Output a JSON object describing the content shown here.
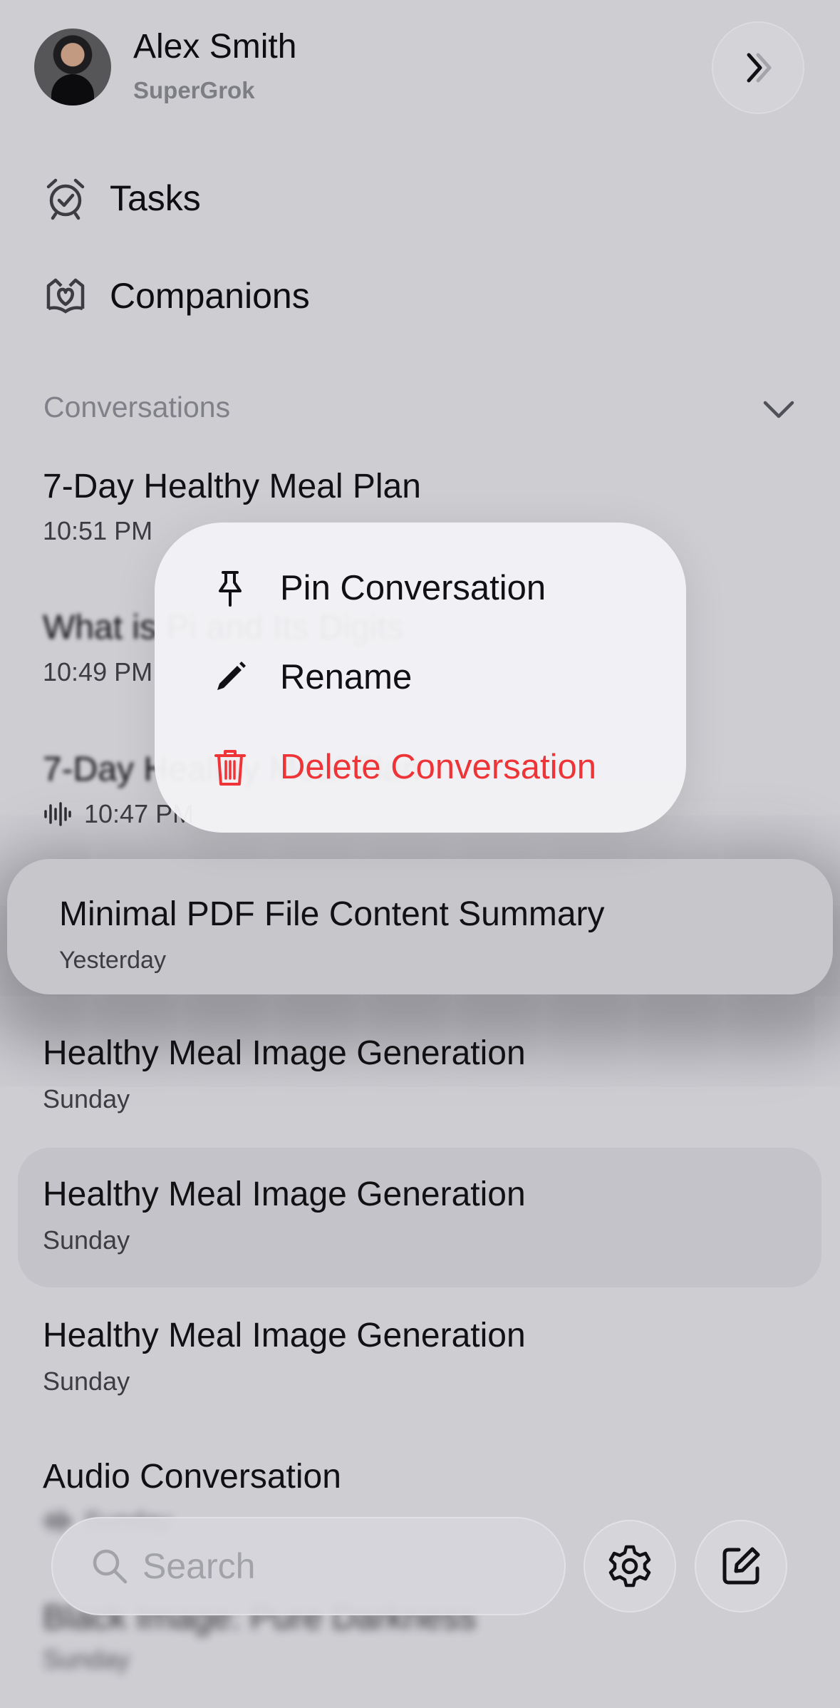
{
  "user": {
    "name": "Alex Smith",
    "plan": "SuperGrok"
  },
  "nav": {
    "tasks_label": "Tasks",
    "companions_label": "Companions"
  },
  "conversations": {
    "section_title": "Conversations",
    "items": [
      {
        "title": "7-Day Healthy Meal Plan",
        "time": "10:51 PM"
      },
      {
        "title": "What is Pi and Its Digits",
        "time": "10:49 PM"
      },
      {
        "title": "7-Day Healthy Meal Plan",
        "time": "10:47 PM",
        "icon": "audio-waveform-icon"
      },
      {
        "title": "Minimal PDF File Content Summary",
        "time": "Yesterday"
      },
      {
        "title": "Healthy Meal Image Generation",
        "time": "Sunday"
      },
      {
        "title": "Healthy Meal Image Generation",
        "time": "Sunday"
      },
      {
        "title": "Healthy Meal Image Generation",
        "time": "Sunday"
      },
      {
        "title": "Audio Conversation",
        "time": "Sunday",
        "icon": "audio-waveform-icon"
      },
      {
        "title": "Black Image: Pure Darkness",
        "time": "Sunday"
      }
    ]
  },
  "context_menu": {
    "pin_label": "Pin Conversation",
    "rename_label": "Rename",
    "delete_label": "Delete Conversation"
  },
  "bottom_bar": {
    "search_placeholder": "Search"
  },
  "colors": {
    "danger": "#ef3438",
    "background": "#cdcdd2",
    "menu": "#f2f2f6"
  }
}
